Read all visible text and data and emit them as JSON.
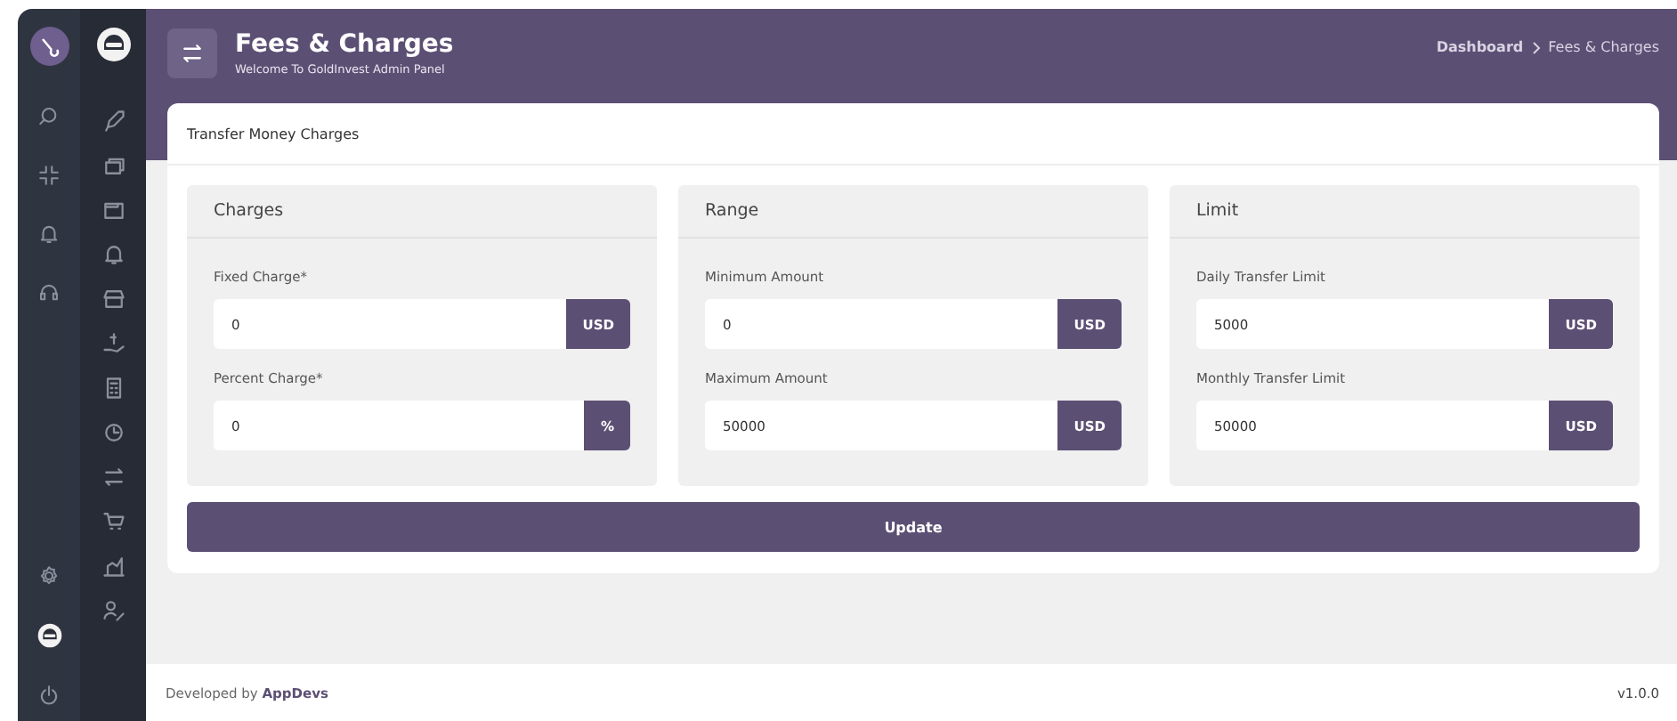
{
  "header": {
    "title": "Fees & Charges",
    "subtitle": "Welcome To GoldInvest Admin Panel",
    "breadcrumb": [
      {
        "label": "Dashboard",
        "current": false
      },
      {
        "label": "Fees & Charges",
        "current": true
      }
    ]
  },
  "card": {
    "title": "Transfer Money Charges",
    "sections": [
      {
        "title": "Charges",
        "fields": [
          {
            "label": "Fixed Charge*",
            "value": "0",
            "unit": "USD"
          },
          {
            "label": "Percent Charge*",
            "value": "0",
            "unit": "%"
          }
        ]
      },
      {
        "title": "Range",
        "fields": [
          {
            "label": "Minimum Amount",
            "value": "0",
            "unit": "USD"
          },
          {
            "label": "Maximum Amount",
            "value": "50000",
            "unit": "USD"
          }
        ]
      },
      {
        "title": "Limit",
        "fields": [
          {
            "label": "Daily Transfer Limit",
            "value": "5000",
            "unit": "USD"
          },
          {
            "label": "Monthly Transfer Limit",
            "value": "50000",
            "unit": "USD"
          }
        ]
      }
    ],
    "button": "Update"
  },
  "footer": {
    "credit": "Developed by **AppDevs**",
    "version": "v1.0.0"
  }
}
